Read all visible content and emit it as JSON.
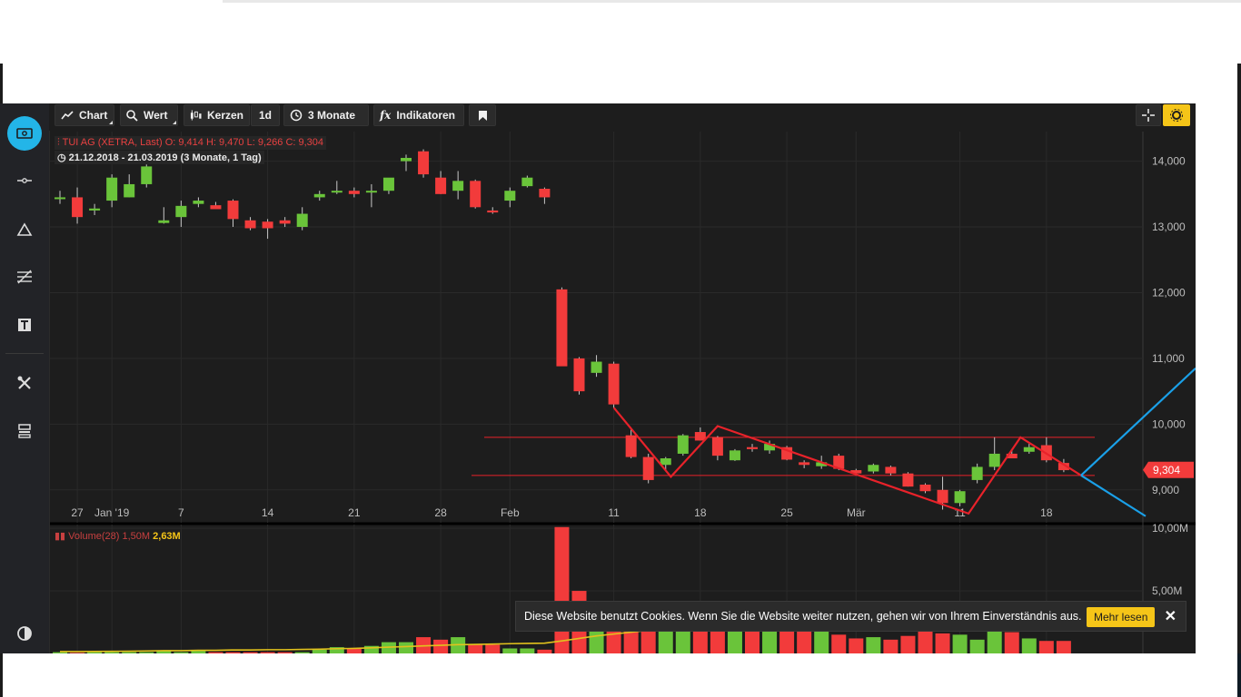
{
  "toolbar": {
    "chart_label": "Chart",
    "value_label": "Wert",
    "candles_label": "Kerzen",
    "interval_label": "1d",
    "range_label": "3 Monate",
    "indicators_label": "Indikatoren"
  },
  "legend": {
    "instrument": "TUI AG (XETRA, Last)",
    "open": "O: 9,414",
    "high": "H: 9,470",
    "low": "L: 9,266",
    "close": "C: 9,304",
    "period": "21.12.2018 - 21.03.2019",
    "period_note": "(3 Monate, 1 Tag)"
  },
  "volume_legend": {
    "label": "Volume(28)",
    "value": "1,50M",
    "value2": "2,63M"
  },
  "price_label": "9,304",
  "cookie": {
    "message": "Diese Website benutzt Cookies. Wenn Sie die Website weiter nutzen, gehen wir von Ihrem Einverständnis aus.",
    "more_label": "Mehr lesen",
    "close_label": "✕"
  },
  "colors": {
    "up": "#6ac43a",
    "down": "#f23b3b",
    "annotation_red": "#e8222a",
    "annotation_blue": "#1aa0e8",
    "ma": "#e2c21d",
    "accent": "#23b5e8"
  },
  "chart_data": {
    "type": "candlestick",
    "y_ticks": [
      "14,000",
      "13,000",
      "12,000",
      "11,000",
      "10,000",
      "9,000"
    ],
    "y_tick_values": [
      14,
      13,
      12,
      11,
      10,
      9
    ],
    "ylim": [
      8.5,
      14.45
    ],
    "x_labels": [
      {
        "label": "27",
        "i": 1
      },
      {
        "label": "Jan '19",
        "i": 3
      },
      {
        "label": "7",
        "i": 7
      },
      {
        "label": "14",
        "i": 12
      },
      {
        "label": "21",
        "i": 17
      },
      {
        "label": "28",
        "i": 22
      },
      {
        "label": "Feb",
        "i": 26
      },
      {
        "label": "11",
        "i": 32
      },
      {
        "label": "18",
        "i": 37
      },
      {
        "label": "25",
        "i": 42
      },
      {
        "label": "Mär",
        "i": 46
      },
      {
        "label": "11",
        "i": 52
      },
      {
        "label": "18",
        "i": 57
      }
    ],
    "candles": [
      {
        "o": 13.45,
        "h": 13.55,
        "l": 13.35,
        "c": 13.45
      },
      {
        "o": 13.45,
        "h": 13.6,
        "l": 13.05,
        "c": 13.15
      },
      {
        "o": 13.25,
        "h": 13.35,
        "l": 13.18,
        "c": 13.28
      },
      {
        "o": 13.4,
        "h": 13.8,
        "l": 13.3,
        "c": 13.75
      },
      {
        "o": 13.45,
        "h": 13.8,
        "l": 13.45,
        "c": 13.65
      },
      {
        "o": 13.65,
        "h": 13.95,
        "l": 13.6,
        "c": 13.92
      },
      {
        "o": 13.06,
        "h": 13.3,
        "l": 13.05,
        "c": 13.1
      },
      {
        "o": 13.15,
        "h": 13.4,
        "l": 13.0,
        "c": 13.32
      },
      {
        "o": 13.35,
        "h": 13.45,
        "l": 13.3,
        "c": 13.4
      },
      {
        "o": 13.33,
        "h": 13.38,
        "l": 13.28,
        "c": 13.27
      },
      {
        "o": 13.4,
        "h": 13.42,
        "l": 13.0,
        "c": 13.12
      },
      {
        "o": 13.1,
        "h": 13.15,
        "l": 12.95,
        "c": 12.98
      },
      {
        "o": 13.08,
        "h": 13.12,
        "l": 12.82,
        "c": 12.98
      },
      {
        "o": 13.1,
        "h": 13.15,
        "l": 13.0,
        "c": 13.05
      },
      {
        "o": 13.0,
        "h": 13.3,
        "l": 12.95,
        "c": 13.2
      },
      {
        "o": 13.45,
        "h": 13.55,
        "l": 13.4,
        "c": 13.5
      },
      {
        "o": 13.55,
        "h": 13.7,
        "l": 13.5,
        "c": 13.55
      },
      {
        "o": 13.55,
        "h": 13.6,
        "l": 13.45,
        "c": 13.5
      },
      {
        "o": 13.55,
        "h": 13.65,
        "l": 13.3,
        "c": 13.55
      },
      {
        "o": 13.55,
        "h": 13.65,
        "l": 13.5,
        "c": 13.75
      },
      {
        "o": 14.0,
        "h": 14.1,
        "l": 13.85,
        "c": 14.05
      },
      {
        "o": 14.15,
        "h": 14.18,
        "l": 13.75,
        "c": 13.8
      },
      {
        "o": 13.75,
        "h": 13.85,
        "l": 13.5,
        "c": 13.5
      },
      {
        "o": 13.55,
        "h": 13.85,
        "l": 13.42,
        "c": 13.7
      },
      {
        "o": 13.7,
        "h": 13.72,
        "l": 13.28,
        "c": 13.3
      },
      {
        "o": 13.25,
        "h": 13.3,
        "l": 13.2,
        "c": 13.22
      },
      {
        "o": 13.4,
        "h": 13.6,
        "l": 13.3,
        "c": 13.55
      },
      {
        "o": 13.62,
        "h": 13.78,
        "l": 13.6,
        "c": 13.75
      },
      {
        "o": 13.58,
        "h": 13.6,
        "l": 13.35,
        "c": 13.45
      },
      {
        "o": 12.05,
        "h": 12.08,
        "l": 10.9,
        "c": 10.88
      },
      {
        "o": 11.0,
        "h": 11.02,
        "l": 10.45,
        "c": 10.5
      },
      {
        "o": 10.78,
        "h": 11.05,
        "l": 10.72,
        "c": 10.95
      },
      {
        "o": 10.92,
        "h": 10.95,
        "l": 10.25,
        "c": 10.3
      },
      {
        "o": 9.83,
        "h": 9.92,
        "l": 9.48,
        "c": 9.5
      },
      {
        "o": 9.5,
        "h": 9.55,
        "l": 9.1,
        "c": 9.15
      },
      {
        "o": 9.38,
        "h": 9.5,
        "l": 9.3,
        "c": 9.48
      },
      {
        "o": 9.55,
        "h": 9.85,
        "l": 9.52,
        "c": 9.83
      },
      {
        "o": 9.88,
        "h": 9.95,
        "l": 9.75,
        "c": 9.75
      },
      {
        "o": 9.8,
        "h": 9.82,
        "l": 9.45,
        "c": 9.52
      },
      {
        "o": 9.45,
        "h": 9.62,
        "l": 9.44,
        "c": 9.6
      },
      {
        "o": 9.65,
        "h": 9.7,
        "l": 9.58,
        "c": 9.62
      },
      {
        "o": 9.6,
        "h": 9.75,
        "l": 9.55,
        "c": 9.7
      },
      {
        "o": 9.65,
        "h": 9.67,
        "l": 9.45,
        "c": 9.46
      },
      {
        "o": 9.42,
        "h": 9.45,
        "l": 9.33,
        "c": 9.38
      },
      {
        "o": 9.36,
        "h": 9.52,
        "l": 9.32,
        "c": 9.42
      },
      {
        "o": 9.52,
        "h": 9.55,
        "l": 9.3,
        "c": 9.32
      },
      {
        "o": 9.3,
        "h": 9.32,
        "l": 9.22,
        "c": 9.25
      },
      {
        "o": 9.28,
        "h": 9.4,
        "l": 9.25,
        "c": 9.38
      },
      {
        "o": 9.35,
        "h": 9.37,
        "l": 9.22,
        "c": 9.25
      },
      {
        "o": 9.25,
        "h": 9.27,
        "l": 9.05,
        "c": 9.05
      },
      {
        "o": 9.08,
        "h": 9.1,
        "l": 8.95,
        "c": 8.98
      },
      {
        "o": 9.0,
        "h": 9.2,
        "l": 8.7,
        "c": 8.8
      },
      {
        "o": 8.8,
        "h": 9.0,
        "l": 8.75,
        "c": 8.98
      },
      {
        "o": 9.15,
        "h": 9.4,
        "l": 9.1,
        "c": 9.35
      },
      {
        "o": 9.35,
        "h": 9.8,
        "l": 9.3,
        "c": 9.55
      },
      {
        "o": 9.55,
        "h": 9.6,
        "l": 9.48,
        "c": 9.48
      },
      {
        "o": 9.58,
        "h": 9.7,
        "l": 9.55,
        "c": 9.65
      },
      {
        "o": 9.68,
        "h": 9.8,
        "l": 9.42,
        "c": 9.45
      },
      {
        "o": 9.41,
        "h": 9.47,
        "l": 9.27,
        "c": 9.3
      }
    ],
    "volume": {
      "ticks": [
        "10,00M",
        "5,00M"
      ],
      "tick_values": [
        10,
        5
      ],
      "ylim": [
        0,
        10.3
      ],
      "values": [
        0.1,
        0.05,
        0.1,
        0.1,
        0.1,
        0.1,
        0.2,
        0.1,
        0.2,
        0.1,
        0.1,
        0.1,
        0.1,
        0.1,
        0.1,
        0.3,
        0.5,
        0.4,
        0.6,
        0.9,
        0.9,
        1.3,
        1.1,
        1.3,
        0.7,
        0.7,
        0.4,
        0.4,
        0.3,
        10.1,
        5.0,
        3.5,
        4.2,
        3.8,
        3.2,
        2.6,
        3.0,
        2.5,
        2.2,
        2.1,
        2.3,
        2.0,
        2.0,
        1.9,
        2.0,
        1.5,
        1.2,
        1.3,
        1.1,
        1.4,
        1.8,
        1.6,
        1.5,
        1.1,
        1.9,
        1.7,
        1.2,
        1.0,
        1.0
      ],
      "ma": [
        0.15,
        0.15,
        0.16,
        0.17,
        0.18,
        0.2,
        0.22,
        0.22,
        0.25,
        0.25,
        0.28,
        0.28,
        0.3,
        0.3,
        0.32,
        0.34,
        0.38,
        0.4,
        0.45,
        0.5,
        0.55,
        0.6,
        0.65,
        0.7,
        0.72,
        0.75,
        0.78,
        0.8,
        0.82,
        1.0,
        1.2,
        1.4,
        1.55,
        1.7,
        1.85,
        1.95,
        2.05,
        2.15,
        2.2,
        2.28,
        2.35,
        2.4,
        2.45,
        2.5,
        2.55,
        2.57,
        2.58,
        2.6,
        2.6,
        2.61,
        2.62,
        2.62,
        2.63,
        2.63,
        2.63,
        2.63,
        2.63,
        2.63,
        2.63
      ]
    },
    "support_resistance": [
      9.8,
      9.22
    ],
    "current_price": 9.304
  }
}
